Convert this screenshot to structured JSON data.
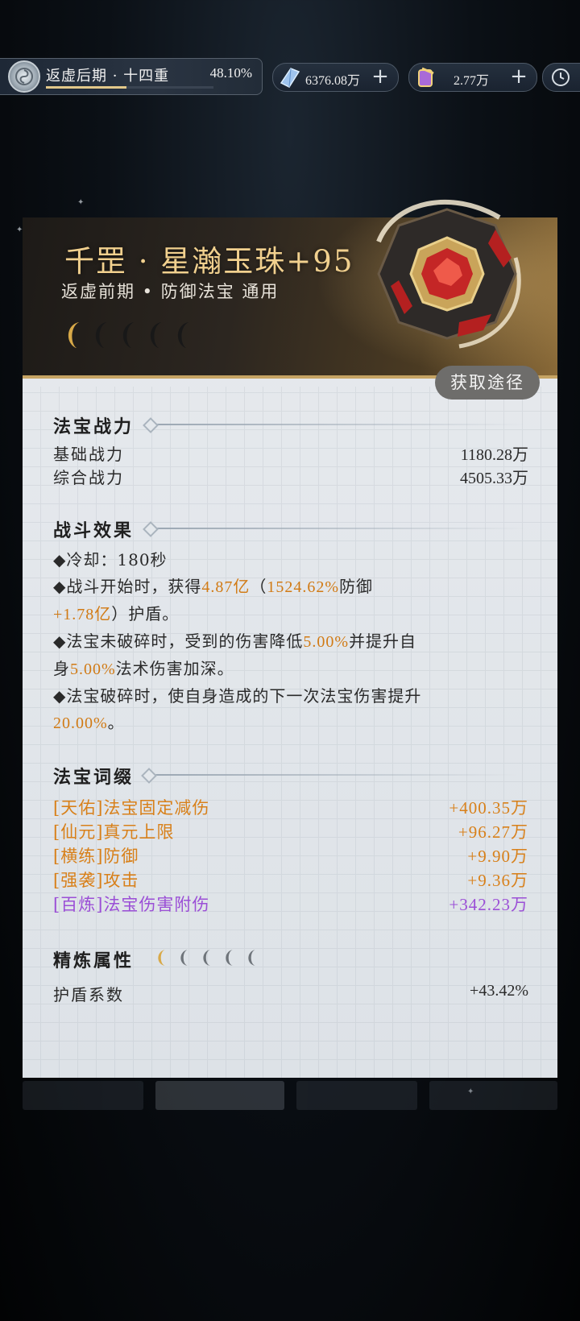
{
  "topbar": {
    "realm_name": "返虚后期 · 十四重",
    "realm_percent": "48.10%",
    "realm_progress": 0.481,
    "currencies": [
      {
        "icon": "spirit-crystal-icon",
        "value": "6376.08万",
        "plus": "+"
      },
      {
        "icon": "scroll-token-icon",
        "value": "2.77万",
        "plus": "+"
      }
    ],
    "clock_icon": "clock-icon"
  },
  "item": {
    "title": "千罡 · 星瀚玉珠+95",
    "subtitle": "返虚前期 • 防御法宝 通用",
    "moons_filled": 1,
    "moons_total": 5,
    "source_button": "获取途径",
    "image_icon": "jade-orb-icon"
  },
  "power": {
    "title": "法宝战力",
    "rows": [
      {
        "label": "基础战力",
        "value": "1180.28万"
      },
      {
        "label": "综合战力",
        "value": "4505.33万"
      }
    ]
  },
  "combat": {
    "title": "战斗效果",
    "e1": "◆冷却：180秒",
    "e2_a": "◆战斗开始时，获得",
    "e2_b": "4.87亿",
    "e2_c": "（",
    "e2_d": "1524.62%",
    "e2_e": "防御",
    "e2_f": "+",
    "e2_g": "1.78亿",
    "e2_h": "）护盾。",
    "e3_a": "◆法宝未破碎时，受到的伤害降低",
    "e3_b": "5.00%",
    "e3_c": "并提升自",
    "e3_d": "身",
    "e3_e": "5.00%",
    "e3_f": "法术伤害加深。",
    "e4_a": "◆法宝破碎时，使自身造成的下一次法宝伤害提升",
    "e4_b": "20.00%",
    "e4_c": "。"
  },
  "affixes": {
    "title": "法宝词缀",
    "rows": [
      {
        "label": "[天佑]法宝固定减伤",
        "value": "+400.35万",
        "color": "#d8801a"
      },
      {
        "label": "[仙元]真元上限",
        "value": "+96.27万",
        "color": "#d8801a"
      },
      {
        "label": "[横练]防御",
        "value": "+9.90万",
        "color": "#d8801a"
      },
      {
        "label": "[强袭]攻击",
        "value": "+9.36万",
        "color": "#d8801a"
      },
      {
        "label": "[百炼]法宝伤害附伤",
        "value": "+342.23万",
        "color": "#9b4fd6"
      }
    ]
  },
  "refine": {
    "title": "精炼属性",
    "moons_filled": 1,
    "moons_total": 5,
    "rows": [
      {
        "label": "护盾系数",
        "value": "+43.42%"
      }
    ]
  },
  "colors": {
    "gold": "#f1d08e",
    "orange_highlight": "#d17a14",
    "purple_affix": "#9b4fd6"
  }
}
